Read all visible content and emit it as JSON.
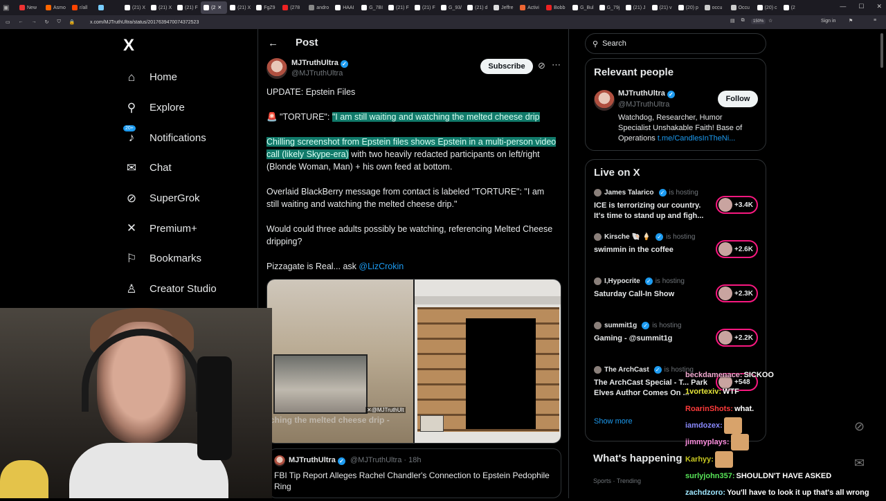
{
  "browser": {
    "tabs": [
      {
        "label": "New",
        "color": "#e33"
      },
      {
        "label": "Asmo",
        "color": "#f60"
      },
      {
        "label": "r/all",
        "color": "#f40"
      },
      {
        "label": "",
        "color": "#7cf"
      },
      {
        "label": "(21) X",
        "color": "#fff"
      },
      {
        "label": "(21) X",
        "color": "#fff"
      },
      {
        "label": "(21) F",
        "color": "#fff"
      },
      {
        "label": "(2",
        "color": "#fff",
        "active": true
      },
      {
        "label": "(21) X",
        "color": "#fff"
      },
      {
        "label": "FgZ9",
        "color": "#fff"
      },
      {
        "label": "(278",
        "color": "#e22"
      },
      {
        "label": "andro",
        "color": "#888"
      },
      {
        "label": "HAAI",
        "color": "#fff"
      },
      {
        "label": "G_7BI",
        "color": "#fff"
      },
      {
        "label": "(21) F",
        "color": "#fff"
      },
      {
        "label": "(21) F",
        "color": "#fff"
      },
      {
        "label": "G_93/",
        "color": "#fff"
      },
      {
        "label": "(21) d",
        "color": "#fff"
      },
      {
        "label": "Jeffre",
        "color": "#ddd"
      },
      {
        "label": "Activi",
        "color": "#e63"
      },
      {
        "label": "Bobb",
        "color": "#e22"
      },
      {
        "label": "G_Bul",
        "color": "#fff"
      },
      {
        "label": "G_79j",
        "color": "#fff"
      },
      {
        "label": "(21) J",
        "color": "#fff"
      },
      {
        "label": "(21) v",
        "color": "#fff"
      },
      {
        "label": "(20) p",
        "color": "#fff"
      },
      {
        "label": "occu",
        "color": "#ccc"
      },
      {
        "label": "Occu",
        "color": "#ccc"
      },
      {
        "label": "(20) c",
        "color": "#fff"
      },
      {
        "label": "(2",
        "color": "#fff"
      }
    ],
    "url": "x.com/MJTruthUltra/status/2017639470074372523",
    "zoom": "150%",
    "signin": "Sign in"
  },
  "nav": {
    "logo": "X",
    "items": [
      {
        "label": "Home",
        "icon": "home-icon",
        "glyph": "⌂"
      },
      {
        "label": "Explore",
        "icon": "search-icon",
        "glyph": "⚲"
      },
      {
        "label": "Notifications",
        "icon": "bell-icon",
        "glyph": "♪",
        "badge": "20+"
      },
      {
        "label": "Chat",
        "icon": "mail-icon",
        "glyph": "✉"
      },
      {
        "label": "SuperGrok",
        "icon": "grok-icon",
        "glyph": "⊘"
      },
      {
        "label": "Premium+",
        "icon": "x-premium-icon",
        "glyph": "✕"
      },
      {
        "label": "Bookmarks",
        "icon": "bookmark-icon",
        "glyph": "⚐"
      },
      {
        "label": "Creator Studio",
        "icon": "creator-studio-icon",
        "glyph": "♙"
      }
    ]
  },
  "post": {
    "header": "Post",
    "author_name": "MJTruthUltra",
    "author_handle": "@MJTruthUltra",
    "subscribe_label": "Subscribe",
    "line1": "UPDATE: Epstein Files",
    "line2_prefix": "🚨 \"TORTURE\": ",
    "line2_highlight": "\"I am still waiting and watching the melted cheese drip",
    "line3_highlight": "Chilling screenshot from Epstein files shows Epstein in a multi-person video call (likely Skype-era)",
    "line3_rest": " with two heavily redacted participants on left/right (Blonde Woman, Man) + his own feed at bottom.",
    "line4": "Overlaid BlackBerry message from contact is labeled \"TORTURE\": \"I am still waiting and watching the melted cheese drip.\"",
    "line5": "Would could three adults possibly be watching, referencing Melted Cheese dripping?",
    "line6_prefix": "Pizzagate is Real... ask ",
    "line6_mention": "@LizCrokin",
    "media_caption": "tching the melted cheese drip -",
    "media_tag": "✕@MJTruthUlt",
    "quoted": {
      "author_name": "MJTruthUltra",
      "meta": "@MJTruthUltra · 18h",
      "text": "FBI Tip Report Alleges Rachel Chandler's Connection to Epstein Pedophile Ring"
    }
  },
  "sidebar": {
    "search_placeholder": "Search",
    "relevant_title": "Relevant people",
    "relevant": {
      "name": "MJTruthUltra",
      "handle": "@MJTruthUltra",
      "bio": "Watchdog, Researcher, Humor Specialist Unshakable Faith! Base of Operations ",
      "bio_link": "t.me/CandlesInTheNi...",
      "follow_label": "Follow"
    },
    "live_title": "Live on X",
    "live": [
      {
        "host": "James Talarico",
        "status": "is hosting",
        "title": "ICE is terrorizing our country. It's time to stand up and figh...",
        "count": "+3.4K"
      },
      {
        "host": "Kirsche 🐚 🍦",
        "status": "is hosting",
        "title": "swimmin in the coffee",
        "count": "+2.6K"
      },
      {
        "host": "I,Hypocrite",
        "status": "is hosting",
        "title": "Saturday Call-In Show",
        "count": "+2.3K"
      },
      {
        "host": "summit1g",
        "status": "is hosting",
        "title": "Gaming - @summit1g",
        "count": "+2.2K"
      },
      {
        "host": "The ArchCast",
        "status": "is hosting",
        "title": "The ArchCast Special - T... Park Elves Author Comes On ...",
        "count": "+548"
      }
    ],
    "show_more": "Show more",
    "happening_title": "What's happening",
    "trend_meta": "Sports · Trending"
  },
  "chat": [
    {
      "user": "beckdamenace",
      "color": "#f2a9d0",
      "text": "SICKOO"
    },
    {
      "user": "1vortexiv",
      "color": "#e6e63a",
      "text": "WTF"
    },
    {
      "user": "RoarinShots",
      "color": "#ff3b3b",
      "text": "what."
    },
    {
      "user": "iamdozex",
      "color": "#8a8aff",
      "text": "",
      "emote": true
    },
    {
      "user": "jimmyplays",
      "color": "#ff8fe0",
      "text": "",
      "emote": true
    },
    {
      "user": "Karhyy",
      "color": "#c8c820",
      "text": "",
      "emote": true
    },
    {
      "user": "surlyjohn357",
      "color": "#58e658",
      "text": "SHOULDN'T HAVE ASKED"
    },
    {
      "user": "zachdzoro",
      "color": "#9fe7ff",
      "text": "You'll have to look it up that's all wrong"
    }
  ]
}
